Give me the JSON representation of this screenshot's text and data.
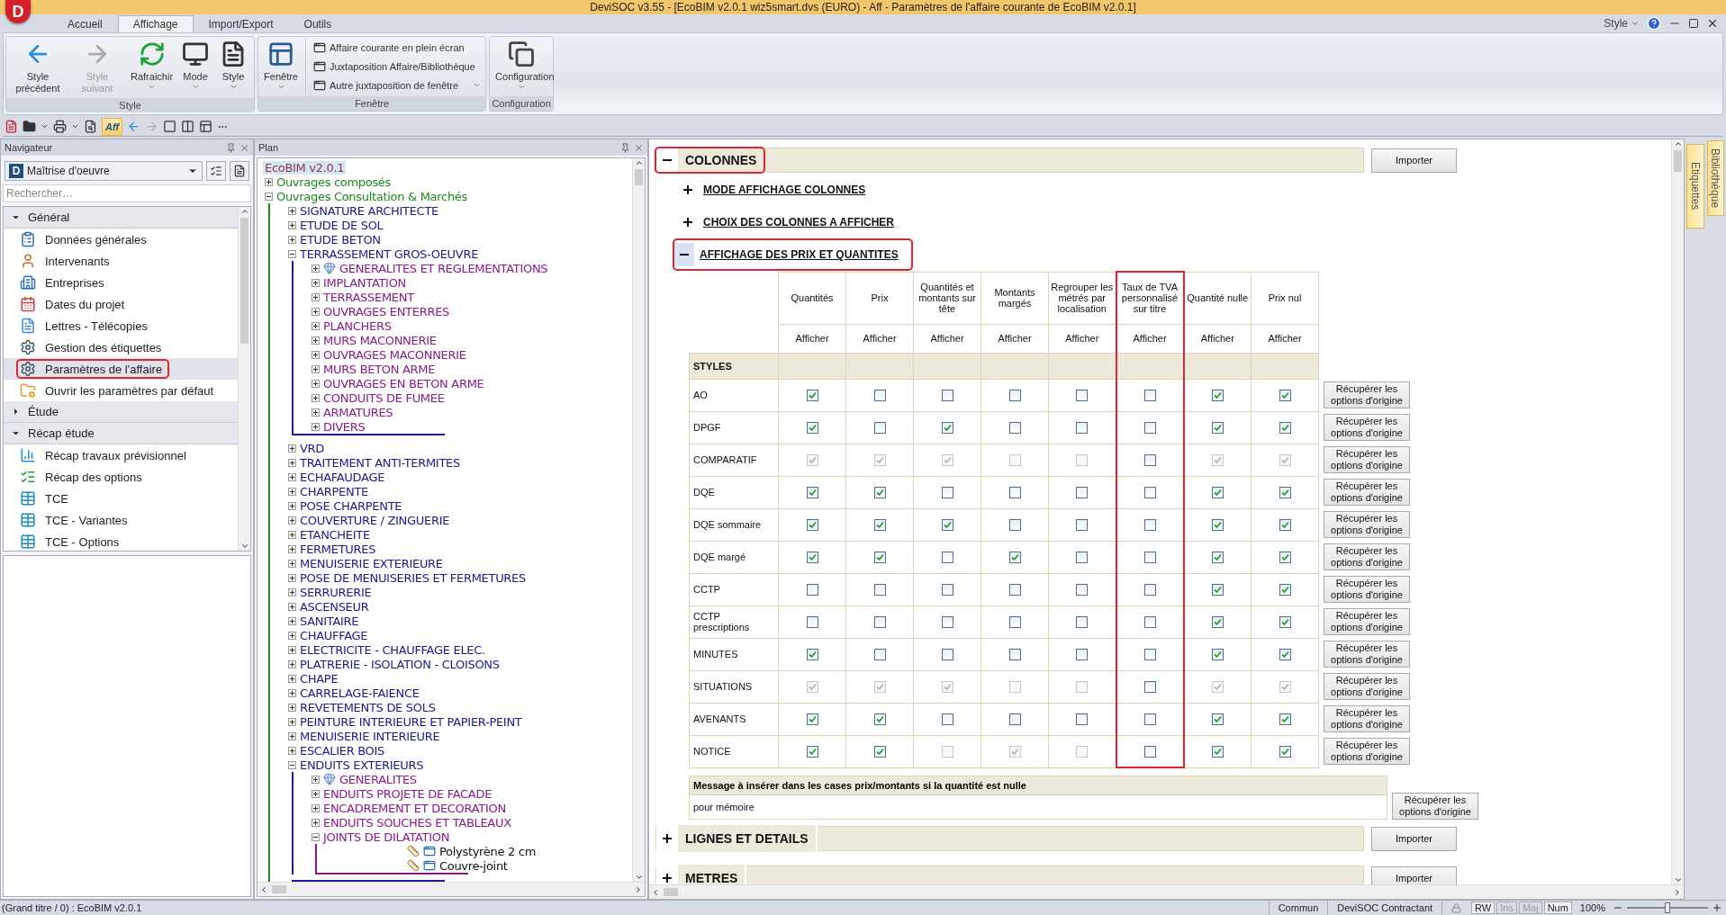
{
  "window": {
    "logo": "D",
    "title": "DeviSOC v3.55 - [EcoBIM v2.0.1 wiz5smart.dvs (EURO) - Aff - Paramètres de l'affaire courante de EcoBIM v2.0.1]"
  },
  "ribbon": {
    "tabs": [
      {
        "label": "Accueil",
        "selected": false
      },
      {
        "label": "Affichage",
        "selected": true
      },
      {
        "label": "Import/Export",
        "selected": false
      },
      {
        "label": "Outils",
        "selected": false
      }
    ],
    "style_menu": "Style",
    "groups": [
      {
        "label": "Style",
        "buttons": [
          {
            "label": "Style précédent",
            "kind": "back",
            "disabled": false,
            "dropdown": false
          },
          {
            "label": "Style suivant",
            "kind": "forward",
            "disabled": true,
            "dropdown": false
          },
          {
            "label": "Rafraichir",
            "kind": "refresh",
            "disabled": false,
            "dropdown": true
          },
          {
            "label": "Mode",
            "kind": "monitor",
            "disabled": false,
            "dropdown": true
          },
          {
            "label": "Style",
            "kind": "document",
            "disabled": false,
            "dropdown": true
          }
        ]
      },
      {
        "label": "Fenêtre",
        "buttons": [
          {
            "label": "Fenêtre",
            "kind": "windows",
            "disabled": false,
            "dropdown": true
          }
        ],
        "small_buttons": [
          {
            "label": "Affaire courante en plein écran",
            "dropdown": false
          },
          {
            "label": "Juxtaposition Affaire/Bibliothèque",
            "dropdown": false
          },
          {
            "label": "Autre juxtaposition de fenêtre",
            "dropdown": true
          }
        ]
      },
      {
        "label": "Configuration",
        "buttons": [
          {
            "label": "Configuration",
            "kind": "stack",
            "disabled": false,
            "dropdown": true
          }
        ]
      }
    ]
  },
  "quick_toolbar": {
    "aff_toggle": {
      "label": "Aff",
      "on": true
    }
  },
  "navigator": {
    "title": "Navigateur",
    "profile": {
      "badge": "D",
      "value": "Maîtrise d'oeuvre"
    },
    "search": {
      "placeholder": "Rechercher…"
    },
    "sections": [
      {
        "label": "Général",
        "expanded": true,
        "items": [
          {
            "label": "Données générales",
            "kind": "clipboard",
            "selected": false,
            "highlighted": false
          },
          {
            "label": "Intervenants",
            "kind": "person",
            "selected": false,
            "highlighted": false
          },
          {
            "label": "Entreprises",
            "kind": "building",
            "selected": false,
            "highlighted": false
          },
          {
            "label": "Dates du projet",
            "kind": "calendar",
            "selected": false,
            "highlighted": false
          },
          {
            "label": "Lettres - Télécopies",
            "kind": "letter",
            "selected": false,
            "highlighted": false
          },
          {
            "label": "Gestion des étiquettes",
            "kind": "gear",
            "selected": false,
            "highlighted": false
          },
          {
            "label": "Paramètres de l'affaire",
            "kind": "gear",
            "selected": true,
            "highlighted": true
          },
          {
            "label": "Ouvrir les paramètres par défaut",
            "kind": "folder",
            "selected": false,
            "highlighted": false
          }
        ]
      },
      {
        "label": "Étude",
        "expanded": false
      },
      {
        "label": "Récap étude",
        "expanded": true,
        "items": [
          {
            "label": "Récap travaux prévisionnel",
            "kind": "chart",
            "selected": false,
            "highlighted": false
          },
          {
            "label": "Récap des options",
            "kind": "checklist",
            "selected": false,
            "highlighted": false
          },
          {
            "label": "TCE",
            "kind": "grid",
            "selected": false,
            "highlighted": false
          },
          {
            "label": "TCE - Variantes",
            "kind": "grid",
            "selected": false,
            "highlighted": false
          },
          {
            "label": "TCE - Options",
            "kind": "grid",
            "selected": false,
            "highlighted": false
          }
        ]
      }
    ]
  },
  "plan": {
    "title": "Plan",
    "tree": {
      "label": "EcoBIM v2.0.1",
      "selected": true,
      "children": [
        {
          "label": "Ouvrages composés",
          "expanded": false
        },
        {
          "label": "Ouvrages Consultation & Marchés",
          "expanded": true,
          "children": [
            {
              "label": "SIGNATURE ARCHITECTE",
              "expanded": false
            },
            {
              "label": "ETUDE DE SOL",
              "expanded": false
            },
            {
              "label": "ETUDE BETON",
              "expanded": false
            },
            {
              "label": "TERRASSEMENT GROS-OEUVRE",
              "expanded": true,
              "children": [
                {
                  "label": "GENERALITES ET REGLEMENTATIONS",
                  "kind": "group",
                  "expanded": false
                },
                {
                  "label": "IMPLANTATION",
                  "kind": "chapter",
                  "expanded": false
                },
                {
                  "label": "TERRASSEMENT",
                  "kind": "chapter",
                  "expanded": false
                },
                {
                  "label": "OUVRAGES ENTERRES",
                  "kind": "chapter",
                  "expanded": false
                },
                {
                  "label": "PLANCHERS",
                  "kind": "chapter",
                  "expanded": false
                },
                {
                  "label": "MURS MACONNERIE",
                  "kind": "chapter",
                  "expanded": false
                },
                {
                  "label": "OUVRAGES MACONNERIE",
                  "kind": "chapter",
                  "expanded": false
                },
                {
                  "label": "MURS BETON ARME",
                  "kind": "chapter",
                  "expanded": false
                },
                {
                  "label": "OUVRAGES EN BETON ARME",
                  "kind": "chapter",
                  "expanded": false
                },
                {
                  "label": "CONDUITS DE FUMEE",
                  "kind": "chapter",
                  "expanded": false
                },
                {
                  "label": "ARMATURES",
                  "kind": "chapter",
                  "expanded": false
                },
                {
                  "label": "DIVERS",
                  "kind": "chapter",
                  "expanded": false
                }
              ]
            },
            {
              "label": "VRD",
              "expanded": false
            },
            {
              "label": "TRAITEMENT ANTI-TERMITES",
              "expanded": false
            },
            {
              "label": "ECHAFAUDAGE",
              "expanded": false
            },
            {
              "label": "CHARPENTE",
              "expanded": false
            },
            {
              "label": "POSE CHARPENTE",
              "expanded": false
            },
            {
              "label": "COUVERTURE / ZINGUERIE",
              "expanded": false
            },
            {
              "label": "ETANCHEITE",
              "expanded": false
            },
            {
              "label": "FERMETURES",
              "expanded": false
            },
            {
              "label": "MENUISERIE EXTERIEURE",
              "expanded": false
            },
            {
              "label": "POSE DE MENUISERIES ET FERMETURES",
              "expanded": false
            },
            {
              "label": "SERRURERIE",
              "expanded": false
            },
            {
              "label": "ASCENSEUR",
              "expanded": false
            },
            {
              "label": "SANITAIRE",
              "expanded": false
            },
            {
              "label": "CHAUFFAGE",
              "expanded": false
            },
            {
              "label": "ELECTRICITE - CHAUFFAGE ELEC.",
              "expanded": false
            },
            {
              "label": "PLATRERIE - ISOLATION - CLOISONS",
              "expanded": false
            },
            {
              "label": "CHAPE",
              "expanded": false
            },
            {
              "label": "CARRELAGE-FAIENCE",
              "expanded": false
            },
            {
              "label": "REVETEMENTS DE SOLS",
              "expanded": false
            },
            {
              "label": "PEINTURE INTERIEURE ET PAPIER-PEINT",
              "expanded": false
            },
            {
              "label": "MENUISERIE INTERIEURE",
              "expanded": false
            },
            {
              "label": "ESCALIER BOIS",
              "expanded": false
            },
            {
              "label": "ENDUITS EXTERIEURS",
              "expanded": true,
              "children": [
                {
                  "label": "GENERALITES",
                  "kind": "group",
                  "expanded": false
                },
                {
                  "label": "ENDUITS PROJETE DE FACADE",
                  "kind": "chapter",
                  "expanded": false
                },
                {
                  "label": "ENCADREMENT ET DECORATION",
                  "kind": "chapter",
                  "expanded": false
                },
                {
                  "label": "ENDUITS SOUCHES ET TABLEAUX",
                  "kind": "chapter",
                  "expanded": false
                },
                {
                  "label": "JOINTS DE DILATATION",
                  "kind": "chapter",
                  "expanded": true,
                  "children": [
                    {
                      "label": "Polystyrène 2 cm",
                      "kind": "article"
                    },
                    {
                      "label": "Couvre-joint",
                      "kind": "article"
                    }
                  ]
                }
              ]
            }
          ]
        }
      ]
    }
  },
  "main": {
    "sections": [
      {
        "label": "COLONNES",
        "expanded": true,
        "highlighted": true,
        "button": "Importer",
        "subsections": [
          {
            "label": "MODE AFFICHAGE COLONNES",
            "expanded": false,
            "highlighted": false
          },
          {
            "label": "CHOIX DES COLONNES A AFFICHER",
            "expanded": false,
            "highlighted": false
          },
          {
            "label": "AFFICHAGE DES PRIX ET QUANTITES",
            "expanded": true,
            "highlighted": true
          }
        ]
      },
      {
        "label": "LIGNES ET DETAILS",
        "expanded": false,
        "highlighted": false,
        "button": "Importer"
      },
      {
        "label": "METRES",
        "expanded": false,
        "highlighted": false,
        "button": "Importer"
      }
    ],
    "price_table": {
      "columns": [
        {
          "label": "Quantités",
          "action": "Afficher",
          "highlighted": false
        },
        {
          "label": "Prix",
          "action": "Afficher",
          "highlighted": false
        },
        {
          "label": "Quantités et montants sur tête",
          "action": "Afficher",
          "highlighted": false
        },
        {
          "label": "Montants margés",
          "action": "Afficher",
          "highlighted": false
        },
        {
          "label": "Regrouper les métrés par localisation",
          "action": "Afficher",
          "highlighted": false
        },
        {
          "label": "Taux de TVA personnalisé sur titre",
          "action": "Afficher",
          "highlighted": true
        },
        {
          "label": "Quantité nulle",
          "action": "Afficher",
          "highlighted": false
        },
        {
          "label": "Prix nul",
          "action": "Afficher",
          "highlighted": false
        }
      ],
      "group_label": "STYLES",
      "rows": [
        {
          "label": "AO",
          "button": "Récupérer les options d'origine",
          "cells": [
            {
              "checked": true,
              "disabled": false
            },
            {
              "checked": false,
              "disabled": false
            },
            {
              "checked": false,
              "disabled": false
            },
            {
              "checked": false,
              "disabled": false
            },
            {
              "checked": false,
              "disabled": false
            },
            {
              "checked": false,
              "disabled": false
            },
            {
              "checked": true,
              "disabled": false
            },
            {
              "checked": true,
              "disabled": false
            }
          ]
        },
        {
          "label": "DPGF",
          "button": "Récupérer les options d'origine",
          "cells": [
            {
              "checked": true,
              "disabled": false
            },
            {
              "checked": false,
              "disabled": false
            },
            {
              "checked": true,
              "disabled": false
            },
            {
              "checked": false,
              "disabled": false
            },
            {
              "checked": false,
              "disabled": false
            },
            {
              "checked": false,
              "disabled": false
            },
            {
              "checked": true,
              "disabled": false
            },
            {
              "checked": true,
              "disabled": false
            }
          ]
        },
        {
          "label": "COMPARATIF",
          "button": "Récupérer les options d'origine",
          "cells": [
            {
              "checked": true,
              "disabled": true
            },
            {
              "checked": true,
              "disabled": true
            },
            {
              "checked": true,
              "disabled": true
            },
            {
              "checked": false,
              "disabled": true
            },
            {
              "checked": false,
              "disabled": true
            },
            {
              "checked": false,
              "disabled": false
            },
            {
              "checked": true,
              "disabled": true
            },
            {
              "checked": true,
              "disabled": true
            }
          ]
        },
        {
          "label": "DQE",
          "button": "Récupérer les options d'origine",
          "cells": [
            {
              "checked": true,
              "disabled": false
            },
            {
              "checked": true,
              "disabled": false
            },
            {
              "checked": false,
              "disabled": false
            },
            {
              "checked": false,
              "disabled": false
            },
            {
              "checked": false,
              "disabled": false
            },
            {
              "checked": false,
              "disabled": false
            },
            {
              "checked": true,
              "disabled": false
            },
            {
              "checked": true,
              "disabled": false
            }
          ]
        },
        {
          "label": "DQE sommaire",
          "button": "Récupérer les options d'origine",
          "cells": [
            {
              "checked": true,
              "disabled": false
            },
            {
              "checked": true,
              "disabled": false
            },
            {
              "checked": true,
              "disabled": false
            },
            {
              "checked": false,
              "disabled": false
            },
            {
              "checked": false,
              "disabled": false
            },
            {
              "checked": false,
              "disabled": false
            },
            {
              "checked": true,
              "disabled": false
            },
            {
              "checked": true,
              "disabled": false
            }
          ]
        },
        {
          "label": "DQE margé",
          "button": "Récupérer les options d'origine",
          "cells": [
            {
              "checked": true,
              "disabled": false
            },
            {
              "checked": true,
              "disabled": false
            },
            {
              "checked": false,
              "disabled": false
            },
            {
              "checked": true,
              "disabled": false
            },
            {
              "checked": false,
              "disabled": false
            },
            {
              "checked": false,
              "disabled": false
            },
            {
              "checked": true,
              "disabled": false
            },
            {
              "checked": true,
              "disabled": false
            }
          ]
        },
        {
          "label": "CCTP",
          "button": "Récupérer les options d'origine",
          "cells": [
            {
              "checked": false,
              "disabled": false
            },
            {
              "checked": false,
              "disabled": false
            },
            {
              "checked": false,
              "disabled": false
            },
            {
              "checked": false,
              "disabled": false
            },
            {
              "checked": false,
              "disabled": false
            },
            {
              "checked": false,
              "disabled": false
            },
            {
              "checked": true,
              "disabled": false
            },
            {
              "checked": true,
              "disabled": false
            }
          ]
        },
        {
          "label": "CCTP prescriptions",
          "button": "Récupérer les options d'origine",
          "cells": [
            {
              "checked": false,
              "disabled": false
            },
            {
              "checked": false,
              "disabled": false
            },
            {
              "checked": false,
              "disabled": false
            },
            {
              "checked": false,
              "disabled": false
            },
            {
              "checked": false,
              "disabled": false
            },
            {
              "checked": false,
              "disabled": false
            },
            {
              "checked": true,
              "disabled": false
            },
            {
              "checked": true,
              "disabled": false
            }
          ]
        },
        {
          "label": "MINUTES",
          "button": "Récupérer les options d'origine",
          "cells": [
            {
              "checked": true,
              "disabled": false
            },
            {
              "checked": false,
              "disabled": false
            },
            {
              "checked": false,
              "disabled": false
            },
            {
              "checked": false,
              "disabled": false
            },
            {
              "checked": false,
              "disabled": false
            },
            {
              "checked": false,
              "disabled": false
            },
            {
              "checked": true,
              "disabled": false
            },
            {
              "checked": true,
              "disabled": false
            }
          ]
        },
        {
          "label": "SITUATIONS",
          "button": "Récupérer les options d'origine",
          "cells": [
            {
              "checked": true,
              "disabled": true
            },
            {
              "checked": true,
              "disabled": true
            },
            {
              "checked": true,
              "disabled": true
            },
            {
              "checked": false,
              "disabled": true
            },
            {
              "checked": false,
              "disabled": true
            },
            {
              "checked": false,
              "disabled": false
            },
            {
              "checked": true,
              "disabled": true
            },
            {
              "checked": true,
              "disabled": true
            }
          ]
        },
        {
          "label": "AVENANTS",
          "button": "Récupérer les options d'origine",
          "cells": [
            {
              "checked": true,
              "disabled": false
            },
            {
              "checked": true,
              "disabled": false
            },
            {
              "checked": false,
              "disabled": false
            },
            {
              "checked": false,
              "disabled": false
            },
            {
              "checked": false,
              "disabled": false
            },
            {
              "checked": false,
              "disabled": false
            },
            {
              "checked": true,
              "disabled": false
            },
            {
              "checked": true,
              "disabled": false
            }
          ]
        },
        {
          "label": "NOTICE",
          "button": "Récupérer les options d'origine",
          "cells": [
            {
              "checked": true,
              "disabled": false
            },
            {
              "checked": true,
              "disabled": false
            },
            {
              "checked": false,
              "disabled": true
            },
            {
              "checked": true,
              "disabled": true
            },
            {
              "checked": false,
              "disabled": true
            },
            {
              "checked": false,
              "disabled": false
            },
            {
              "checked": true,
              "disabled": false
            },
            {
              "checked": true,
              "disabled": false
            }
          ]
        }
      ]
    },
    "null_message": {
      "label": "Message à insérer dans les cases prix/montants si la quantité est nulle",
      "value": "pour mémoire",
      "button": "Récupérer les options d'origine"
    }
  },
  "right_docks": [
    "Etiquettes",
    "Bibliothèque"
  ],
  "status_bar": {
    "left": "(Grand titre / 0) : EcoBIM v2.0.1",
    "panels": [
      "Commun",
      "DeviSOC Contractant"
    ],
    "indicators": [
      {
        "label": "RW",
        "on": true
      },
      {
        "label": "Ins",
        "on": false
      },
      {
        "label": "Maj",
        "on": false
      },
      {
        "label": "Num",
        "on": true
      }
    ],
    "zoom": {
      "label": "100%",
      "level": 0.5
    }
  }
}
